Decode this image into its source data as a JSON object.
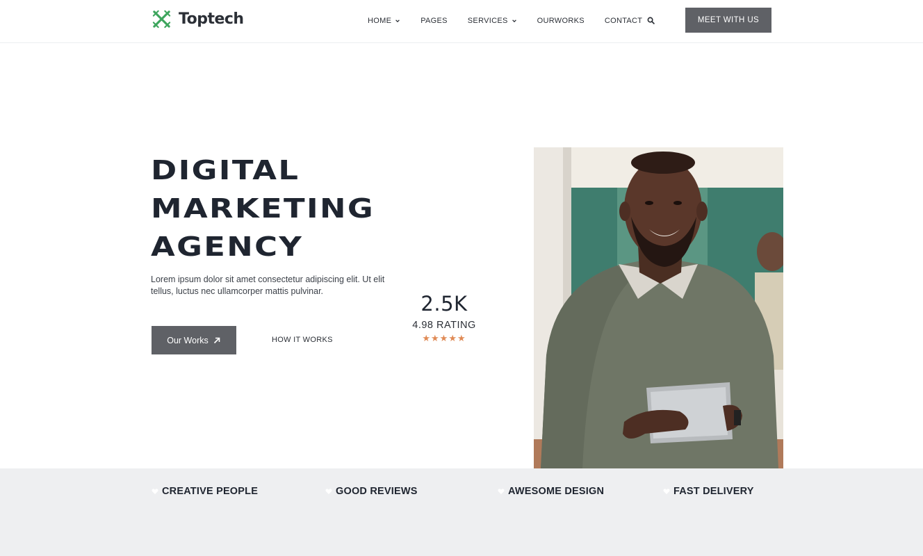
{
  "brand": {
    "name": "Toptech",
    "icon": "logo-x-icon",
    "accent_color": "#3da55d"
  },
  "nav": {
    "items": [
      {
        "label": "HOME",
        "has_dropdown": true
      },
      {
        "label": "PAGES",
        "has_dropdown": false
      },
      {
        "label": "SERVICES",
        "has_dropdown": true
      },
      {
        "label": "OURWORKS",
        "has_dropdown": false
      },
      {
        "label": "CONTACT",
        "has_dropdown": false
      }
    ],
    "search_icon": "search-icon",
    "cta_label": "MEET WITH US"
  },
  "hero": {
    "title_lines": [
      "DIGITAL",
      "MARKETING",
      "AGENCY"
    ],
    "description": "Lorem ipsum dolor sit amet consectetur adipiscing elit. Ut elit tellus, luctus nec ullamcorper mattis pulvinar.",
    "primary_button": "Our Works",
    "secondary_link": "HOW IT WORKS"
  },
  "stat": {
    "value": "2.5K",
    "rating_label": "4.98 RATING",
    "stars": "★★★★★",
    "star_count": 5,
    "star_color": "#e08a55"
  },
  "features": [
    {
      "label": "CREATIVE PEOPLE",
      "icon": "heart-icon"
    },
    {
      "label": "GOOD REVIEWS",
      "icon": "heart-icon"
    },
    {
      "label": "AWESOME DESIGN",
      "icon": "heart-icon"
    },
    {
      "label": "FAST DELIVERY",
      "icon": "heart-icon"
    }
  ],
  "colors": {
    "button_bg": "#5f6166",
    "text_dark": "#1f2530",
    "strip_bg": "#eeeff1"
  }
}
